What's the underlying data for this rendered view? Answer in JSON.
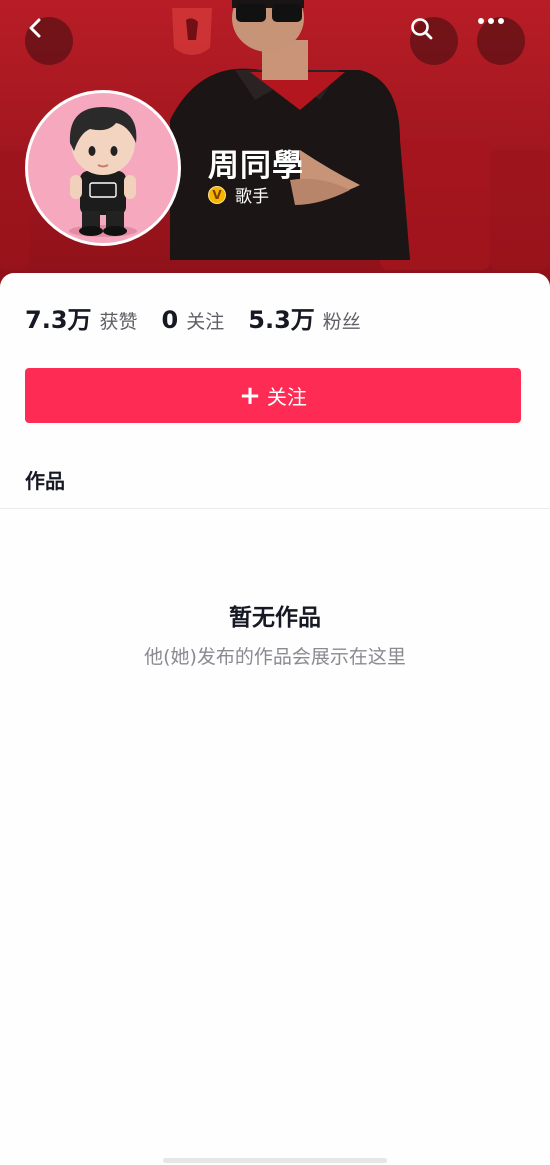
{
  "header": {
    "back_icon": "chevron-left-icon",
    "search_icon": "search-icon",
    "more_icon": "more-horizontal-icon"
  },
  "profile": {
    "nickname": "周同學",
    "verified_badge": "V",
    "tag": "歌手",
    "avatar_color": "#f6a8bf"
  },
  "stats": [
    {
      "value": "7.3万",
      "label": "获赞"
    },
    {
      "value": "0",
      "label": "关注"
    },
    {
      "value": "5.3万",
      "label": "粉丝"
    }
  ],
  "actions": {
    "follow_plus": "+",
    "follow_label": "关注",
    "follow_color": "#fe2c55"
  },
  "tabs": {
    "works": "作品"
  },
  "empty_state": {
    "title": "暂无作品",
    "subtitle": "他(她)发布的作品会展示在这里"
  }
}
